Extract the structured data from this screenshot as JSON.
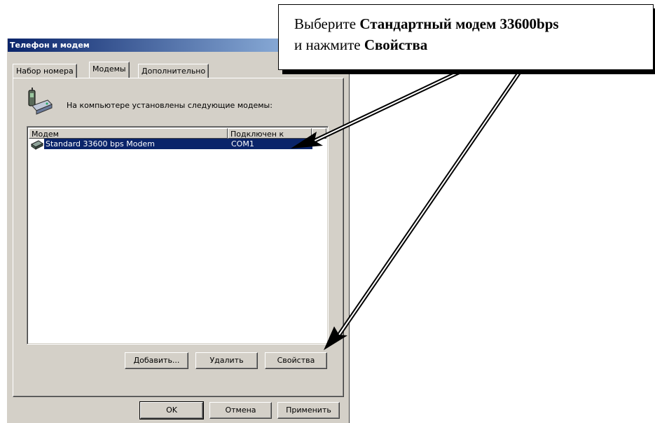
{
  "window": {
    "title": "Телефон и модем"
  },
  "tabs": [
    {
      "label": "Набор номера",
      "active": false
    },
    {
      "label": "Модемы",
      "active": true
    },
    {
      "label": "Дополнительно",
      "active": false
    }
  ],
  "intro_text": "На компьютере установлены следующие модемы:",
  "modem_list": {
    "columns": [
      "Модем",
      "Подключен к"
    ],
    "rows": [
      {
        "modem": "Standard 33600 bps Modem",
        "port": "COM1",
        "selected": true,
        "icon": "modem-device-icon"
      }
    ]
  },
  "list_buttons": {
    "add": "Добавить...",
    "remove": "Удалить",
    "properties": "Свойства"
  },
  "dialog_buttons": {
    "ok": "OK",
    "cancel": "Отмена",
    "apply": "Применить"
  },
  "callout": {
    "line1_prefix": "Выберите ",
    "line1_bold": "Стандартный модем 33600bps",
    "line2_prefix": "и нажмите ",
    "line2_bold": "Свойства"
  },
  "colors": {
    "selection": "#0a246a",
    "title_start": "#0a246a",
    "title_end": "#a6caf0",
    "face": "#d4d0c8"
  }
}
